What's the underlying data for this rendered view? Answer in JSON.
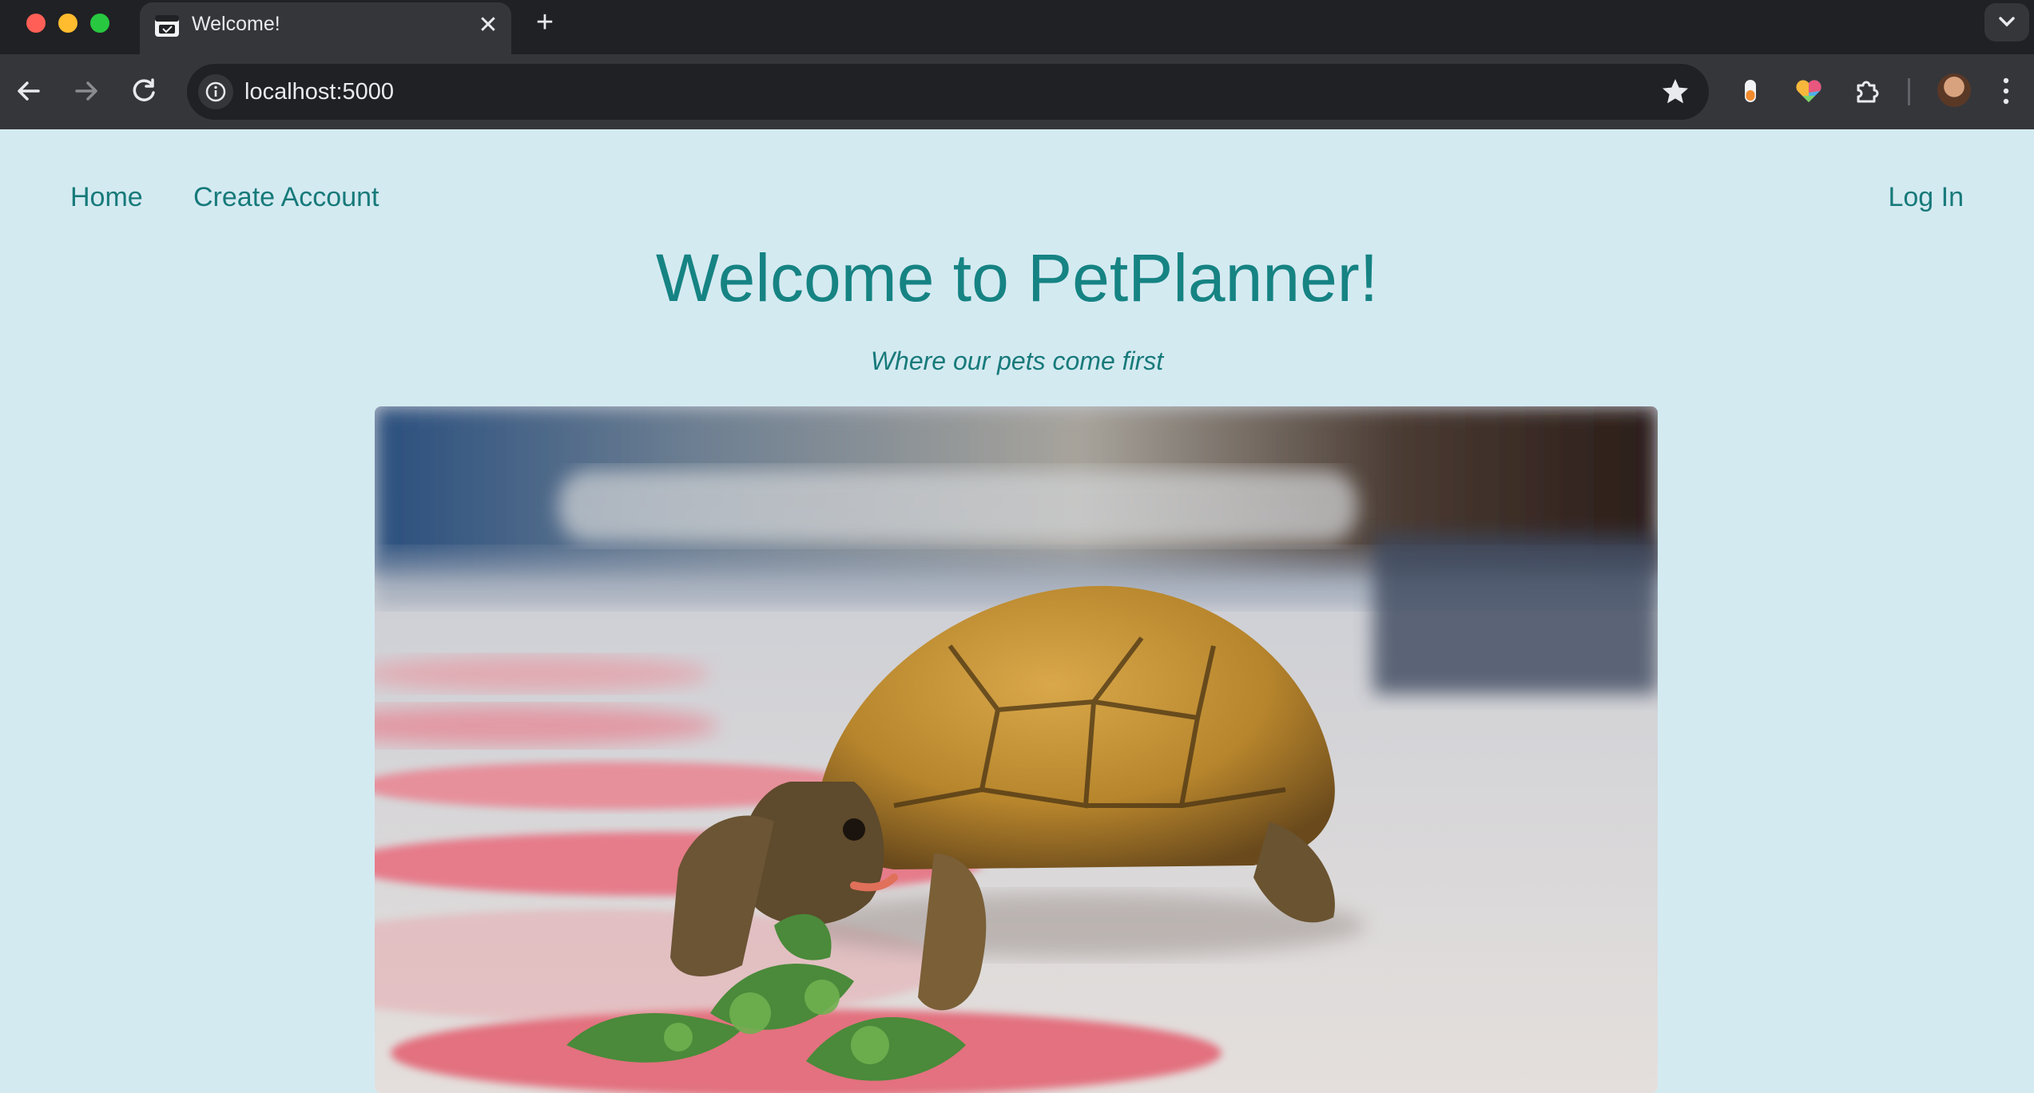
{
  "browser": {
    "tab_title": "Welcome!",
    "tab_close": "✕",
    "new_tab": "+",
    "url": "localhost:5000",
    "icons": [
      "back-arrow-icon",
      "forward-arrow-icon",
      "reload-icon",
      "site-info-icon",
      "bookmark-star-icon",
      "extension-toggle-icon",
      "color-heart-extension-icon",
      "extensions-puzzle-icon",
      "profile-avatar",
      "more-menu-icon"
    ]
  },
  "nav": {
    "home": "Home",
    "create_account": "Create Account",
    "log_in": "Log In"
  },
  "hero": {
    "title": "Welcome to PetPlanner!",
    "tagline": "Where our pets come first",
    "image_subject": "tortoise eating leafy greens on a pink and white rug"
  },
  "colors": {
    "page_background": "#d4eaf1",
    "brand_teal": "#168383",
    "chrome_dark": "#202124",
    "chrome_toolbar": "#35363a"
  }
}
